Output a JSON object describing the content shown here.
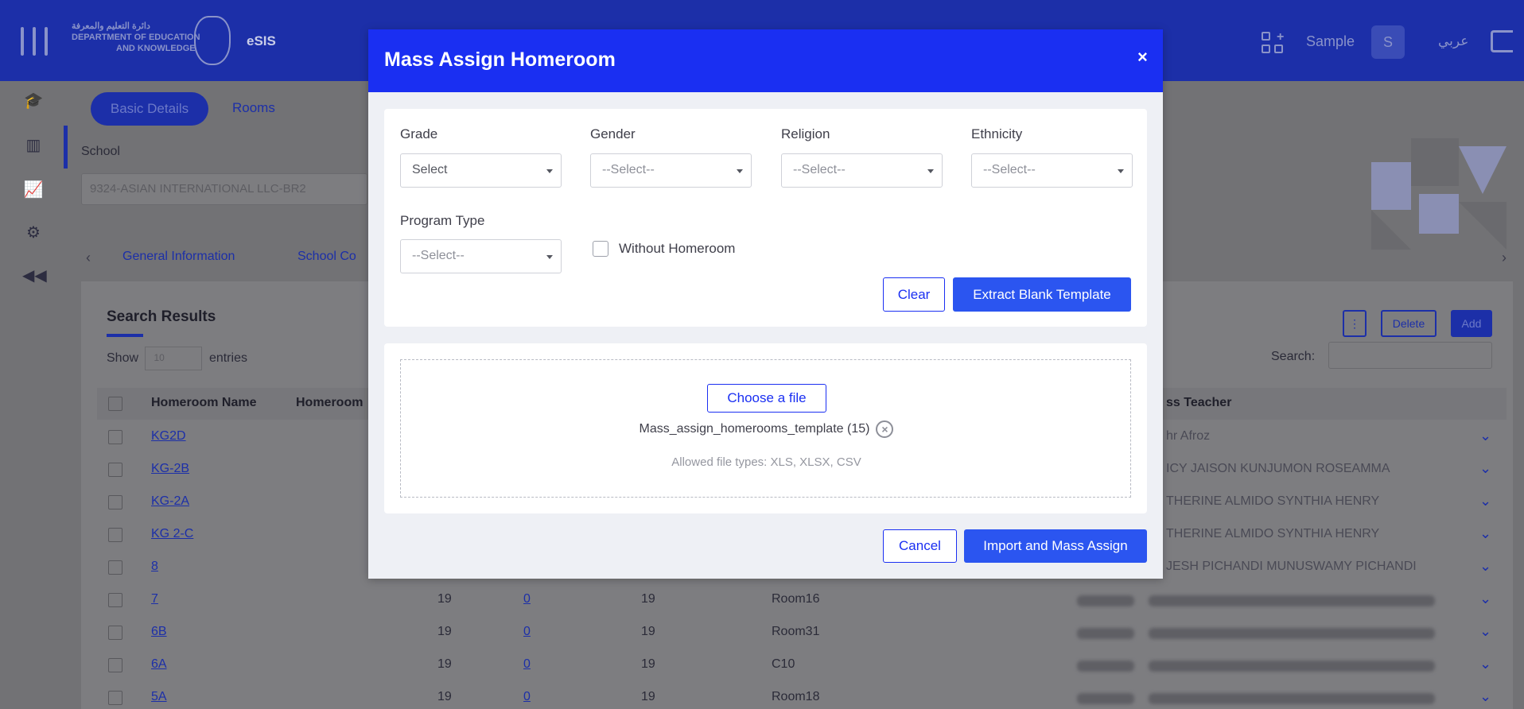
{
  "app": {
    "logo_line1": "دائرة التعليم والمعرفة",
    "logo_line2": "DEPARTMENT OF EDUCATION",
    "logo_line3": "AND KNOWLEDGE",
    "name": "eSIS",
    "user_name": "Sample",
    "user_initial": "S",
    "language_toggle": "عربي"
  },
  "page": {
    "tabs": [
      "Basic Details",
      "Rooms"
    ],
    "school_label": "School",
    "school_value": "9324-ASIAN INTERNATIONAL LLC-BR2",
    "info_tabs": [
      "General Information",
      "School Co"
    ],
    "search_results_title": "Search Results",
    "show_label": "Show",
    "show_value": "10",
    "entries_label": "entries",
    "delete_label": "Delete",
    "add_label": "Add",
    "search_label": "Search:",
    "columns": [
      "Homeroom Name",
      "Homeroom",
      "ss Teacher"
    ],
    "rows": [
      {
        "name": "KG2D",
        "capacity": "",
        "students": "",
        "seats": "",
        "room": "",
        "teacher": "hr Afroz"
      },
      {
        "name": "KG-2B",
        "capacity": "",
        "students": "",
        "seats": "",
        "room": "",
        "teacher": "ICY JAISON KUNJUMON ROSEAMMA"
      },
      {
        "name": "KG-2A",
        "capacity": "",
        "students": "",
        "seats": "",
        "room": "",
        "teacher": "THERINE ALMIDO SYNTHIA HENRY"
      },
      {
        "name": "KG 2-C",
        "capacity": "",
        "students": "",
        "seats": "",
        "room": "",
        "teacher": "THERINE ALMIDO SYNTHIA HENRY"
      },
      {
        "name": "8",
        "capacity": "",
        "students": "",
        "seats": "",
        "room": "",
        "teacher": "JESH PICHANDI MUNUSWAMY PICHANDI"
      },
      {
        "name": "7",
        "capacity": "19",
        "students": "0",
        "seats": "19",
        "room": "Room16",
        "teacher": ""
      },
      {
        "name": "6B",
        "capacity": "19",
        "students": "0",
        "seats": "19",
        "room": "Room31",
        "teacher": ""
      },
      {
        "name": "6A",
        "capacity": "19",
        "students": "0",
        "seats": "19",
        "room": "C10",
        "teacher": ""
      },
      {
        "name": "5A",
        "capacity": "19",
        "students": "0",
        "seats": "19",
        "room": "Room18",
        "teacher": ""
      }
    ]
  },
  "modal": {
    "title": "Mass Assign Homeroom",
    "close_glyph": "×",
    "filters": {
      "grade_label": "Grade",
      "grade_value": "Select",
      "gender_label": "Gender",
      "gender_value": "--Select--",
      "religion_label": "Religion",
      "religion_value": "--Select--",
      "ethnicity_label": "Ethnicity",
      "ethnicity_value": "--Select--",
      "program_type_label": "Program Type",
      "program_type_value": "--Select--",
      "without_homeroom_label": "Without Homeroom",
      "without_homeroom_checked": false
    },
    "clear_label": "Clear",
    "extract_label": "Extract Blank Template",
    "upload": {
      "choose_label": "Choose a file",
      "file_name": "Mass_assign_homerooms_template (15)",
      "allowed_types": "Allowed file types: XLS, XLSX, CSV"
    },
    "cancel_label": "Cancel",
    "import_label": "Import and Mass Assign"
  },
  "colors": {
    "modal_header": "#1a2ff2",
    "primary_button": "#2b55f0",
    "topbar": "#1c2fa8"
  }
}
